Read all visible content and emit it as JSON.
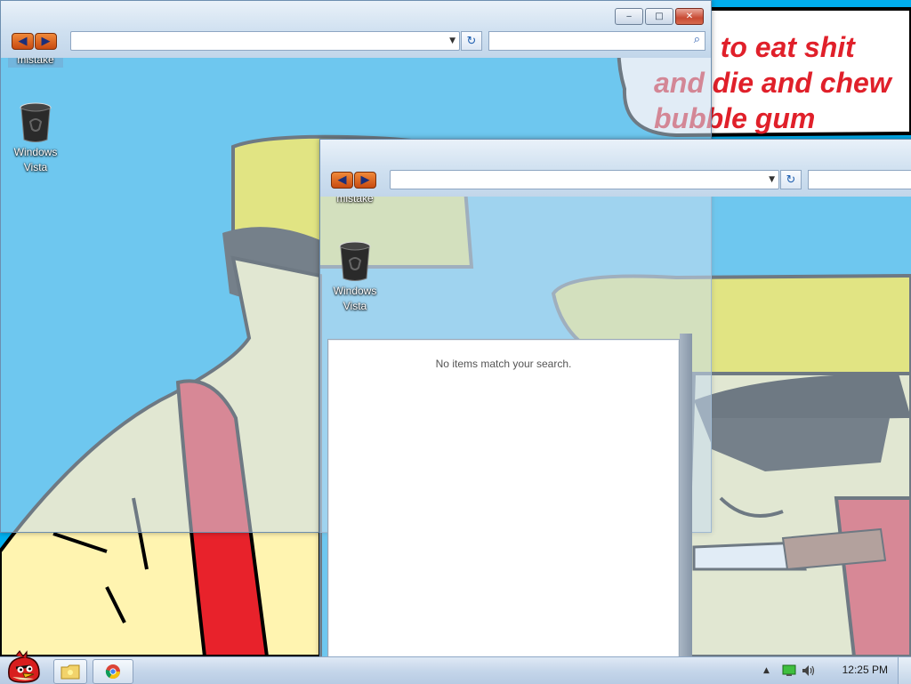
{
  "wallpaper": {
    "speech_bubble_lines": [
      "time to eat shit",
      "and die and chew",
      "bubble gum"
    ],
    "colors": {
      "sky": "#00aeef",
      "hat": "#ffee00",
      "skin": "#fff4b0",
      "shirt": "#e8222b",
      "text": "#e0202a"
    }
  },
  "window_back": {
    "nav": {
      "back_icon": "arrow-left-icon",
      "forward_icon": "arrow-right-icon"
    },
    "address_value": "",
    "search_value": "",
    "caption": {
      "minimize": "‒",
      "maximize": "□",
      "close": "✕"
    },
    "desktop_icons": [
      {
        "label": "mistake"
      },
      {
        "label_line1": "Windows",
        "label_line2": "Vista"
      }
    ]
  },
  "window_front": {
    "address_value": "",
    "search_value": "",
    "desktop_icons": [
      {
        "label": "mistake"
      },
      {
        "label_line1": "Windows",
        "label_line2": "Vista"
      }
    ],
    "results_message": "No items match your search."
  },
  "taskbar": {
    "start_icon": "angry-bird-start-icon",
    "pinned": [
      {
        "name": "explorer-folder-icon"
      },
      {
        "name": "chrome-icon"
      }
    ],
    "tray": {
      "show_hidden": "▲",
      "network_icon": "network-icon",
      "volume_icon": "volume-icon",
      "time": "12:25 PM"
    }
  }
}
